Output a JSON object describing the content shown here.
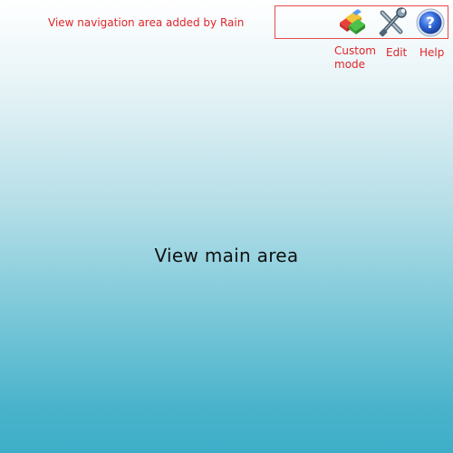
{
  "nav": {
    "caption": "View navigation area added by Rain",
    "buttons": [
      {
        "id": "custom",
        "label": "Custom mode",
        "icon": "custom-mode-icon"
      },
      {
        "id": "edit",
        "label": "Edit",
        "icon": "wrench-screwdriver-icon"
      },
      {
        "id": "help",
        "label": "Help",
        "icon": "question-mark-icon"
      }
    ],
    "label_color": "#e0252a",
    "border_color": "#e64b4b"
  },
  "main": {
    "title": "View main area",
    "gradient_top": "#ffffff",
    "gradient_bottom": "#3eaec8"
  }
}
